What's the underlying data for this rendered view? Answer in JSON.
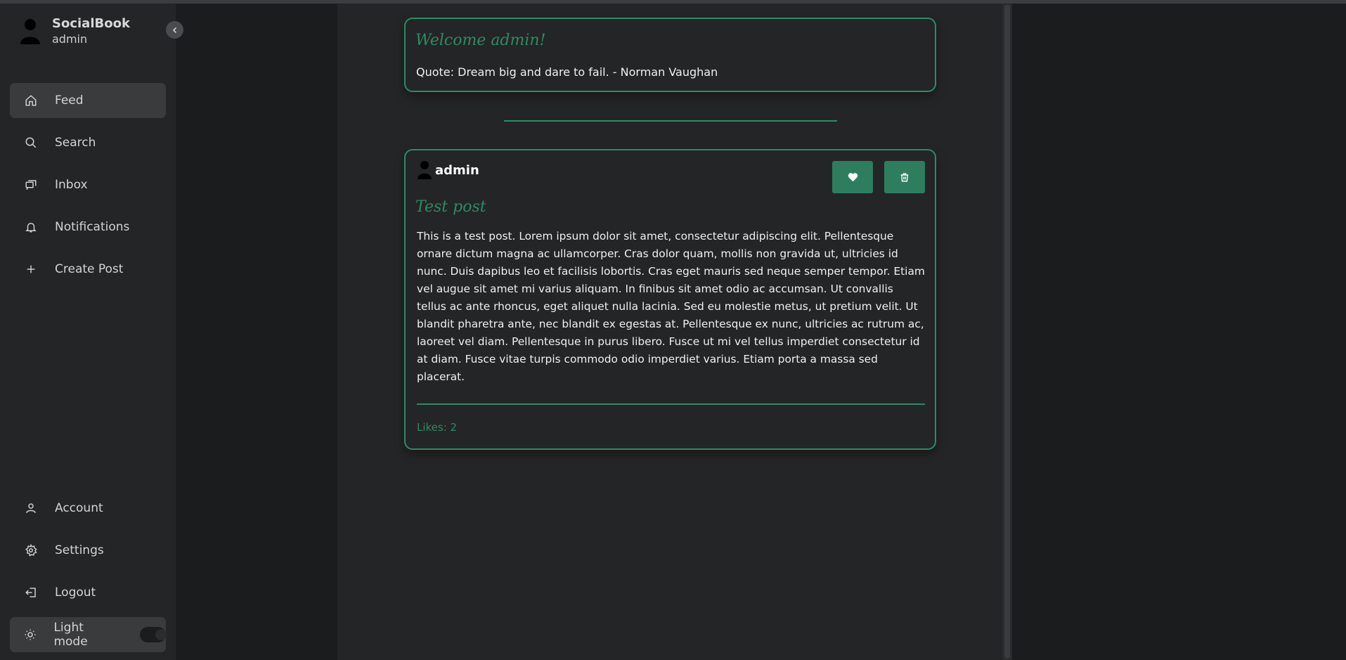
{
  "app": {
    "name": "SocialBook",
    "user": "admin"
  },
  "sidebar": {
    "items": [
      {
        "label": "Feed",
        "icon": "home-icon",
        "active": true
      },
      {
        "label": "Search",
        "icon": "search-icon",
        "active": false
      },
      {
        "label": "Inbox",
        "icon": "inbox-icon",
        "active": false
      },
      {
        "label": "Notifications",
        "icon": "bell-icon",
        "active": false
      },
      {
        "label": "Create Post",
        "icon": "plus-icon",
        "active": false
      }
    ],
    "bottom_items": [
      {
        "label": "Account",
        "icon": "user-icon"
      },
      {
        "label": "Settings",
        "icon": "gear-icon"
      },
      {
        "label": "Logout",
        "icon": "logout-icon"
      }
    ],
    "mode_label": "Light mode",
    "mode_icon": "sun-icon",
    "mode_toggle_on": false
  },
  "welcome": {
    "title": "Welcome admin!",
    "quote": "Quote: Dream big and dare to fail. - Norman Vaughan"
  },
  "post": {
    "author": "admin",
    "title": "Test post",
    "body": "This is a test post. Lorem ipsum dolor sit amet, consectetur adipiscing elit. Pellentesque ornare dictum magna ac ullamcorper. Cras dolor quam, mollis non gravida ut, ultricies id nunc. Duis dapibus leo et facilisis lobortis. Cras eget mauris sed neque semper tempor. Etiam vel augue sit amet mi varius aliquam. In finibus sit amet odio ac accumsan. Ut convallis tellus ac ante rhoncus, eget aliquet nulla lacinia. Sed eu molestie metus, ut pretium velit. Ut blandit pharetra ante, nec blandit ex egestas at. Pellentesque ex nunc, ultricies ac rutrum ac, laoreet vel diam. Pellentesque in purus libero. Fusce ut mi vel tellus imperdiet consectetur id at diam. Fusce vitae turpis commodo odio imperdiet varius. Etiam porta a massa sed placerat.",
    "likes": "Likes: 2",
    "like_icon": "heart-icon",
    "delete_icon": "trash-icon"
  },
  "colors": {
    "accent": "#2e8b64",
    "button": "#2e7d5f",
    "sidebar_bg": "#242526",
    "page_bg": "#1b1c1e"
  }
}
